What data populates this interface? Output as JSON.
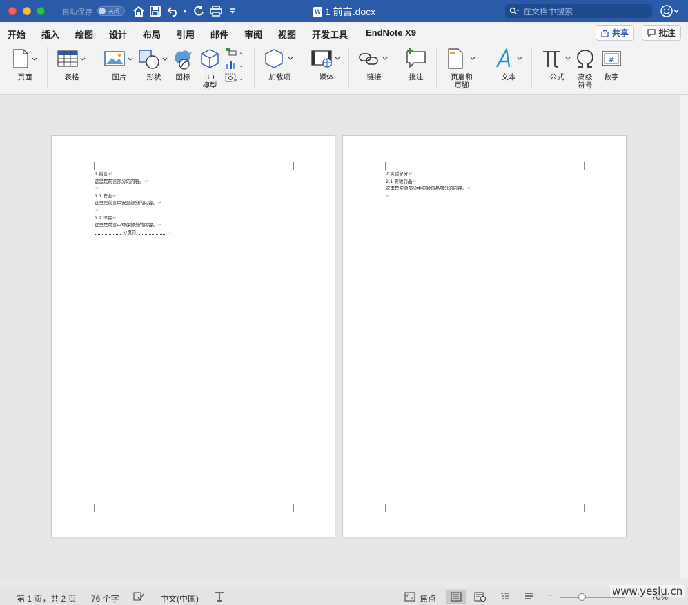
{
  "titlebar": {
    "autosave_label": "自动保存",
    "autosave_state": "关闭",
    "doc_title": "1 前言.docx",
    "search_placeholder": "在文档中搜索"
  },
  "tabs": [
    {
      "label": "开始"
    },
    {
      "label": "插入"
    },
    {
      "label": "绘图"
    },
    {
      "label": "设计"
    },
    {
      "label": "布局"
    },
    {
      "label": "引用"
    },
    {
      "label": "邮件"
    },
    {
      "label": "审阅"
    },
    {
      "label": "视图"
    },
    {
      "label": "开发工具"
    },
    {
      "label": "EndNote X9"
    }
  ],
  "active_tab": "插入",
  "share_label": "共享",
  "comment_label": "批注",
  "ribbon": {
    "page": "页面",
    "table": "表格",
    "picture": "图片",
    "shapes": "形状",
    "icons": "图标",
    "model_line1": "3D",
    "model_line2": "模型",
    "addins": "加载项",
    "media": "媒体",
    "link": "链接",
    "comment": "批注",
    "header_line1": "页眉和",
    "header_line2": "页脚",
    "text": "文本",
    "equation": "公式",
    "symbol_line1": "高级",
    "symbol_line2": "符号",
    "number": "数字"
  },
  "page1": {
    "lines": [
      "1 前言",
      "这里是前言部分的内容。",
      "",
      "1.1 安全",
      "这里是前言中安全部分的内容。",
      "",
      "1.2 环保",
      "这里是前言中环保部分的内容。"
    ],
    "page_break": "分页符"
  },
  "page2": {
    "lines": [
      "2 实验部分",
      "2.1 实验药品",
      "这里是实验部分中实验药品部分的内容。",
      ""
    ]
  },
  "status": {
    "page_info": "第 1 页，共 2 页",
    "word_count": "76 个字",
    "language": "中文(中国)",
    "focus": "焦点",
    "zoom": "70%"
  },
  "watermark": "www.yeslu.cn",
  "colors": {
    "accent": "#2a5aa8",
    "formatting_mark": "#6a9be0"
  }
}
